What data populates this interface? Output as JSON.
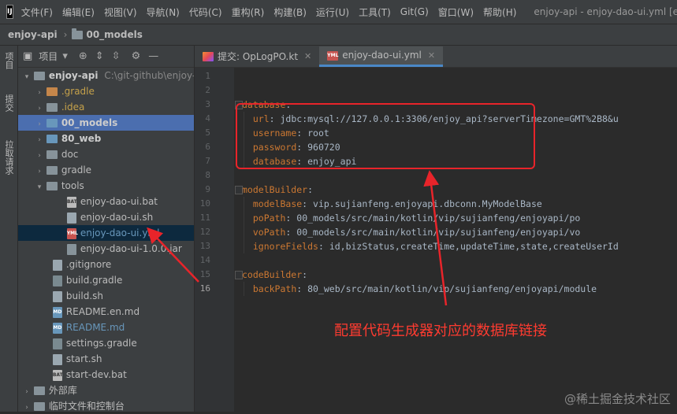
{
  "menubar": {
    "logo": "IJ",
    "items": [
      "文件(F)",
      "编辑(E)",
      "视图(V)",
      "导航(N)",
      "代码(C)",
      "重构(R)",
      "构建(B)",
      "运行(U)",
      "工具(T)",
      "Git(G)",
      "窗口(W)",
      "帮助(H)"
    ],
    "window_title": "enjoy-api - enjoy-dao-ui.yml [en"
  },
  "breadcrumb": {
    "project": "enjoy-api",
    "folder": "00_models"
  },
  "left_stripe": {
    "tab_project": "项目",
    "tab_commit": "提交",
    "tab_pull": "拉取请求"
  },
  "project_panel": {
    "title": "项目",
    "root_name": "enjoy-api",
    "root_path": "C:\\git-github\\enjoy-a",
    "rows": [
      {
        "label": ".gradle",
        "kind": "folder-orange"
      },
      {
        "label": ".idea",
        "kind": "folder-grey"
      },
      {
        "label": "00_models",
        "kind": "folder-blue"
      },
      {
        "label": "80_web",
        "kind": "folder-blue"
      },
      {
        "label": "doc",
        "kind": "folder-grey"
      },
      {
        "label": "gradle",
        "kind": "folder-grey"
      },
      {
        "label": "tools",
        "kind": "folder-grey"
      },
      {
        "label": "enjoy-dao-ui.bat",
        "kind": "bat"
      },
      {
        "label": "enjoy-dao-ui.sh",
        "kind": "sh"
      },
      {
        "label": "enjoy-dao-ui.yml",
        "kind": "yml"
      },
      {
        "label": "enjoy-dao-ui-1.0.0.jar",
        "kind": "jar"
      },
      {
        "label": ".gitignore",
        "kind": "file"
      },
      {
        "label": "build.gradle",
        "kind": "gradle"
      },
      {
        "label": "build.sh",
        "kind": "sh"
      },
      {
        "label": "README.en.md",
        "kind": "md"
      },
      {
        "label": "README.md",
        "kind": "md"
      },
      {
        "label": "settings.gradle",
        "kind": "gradle"
      },
      {
        "label": "start.sh",
        "kind": "sh"
      },
      {
        "label": "start-dev.bat",
        "kind": "bat"
      },
      {
        "label": "外部库",
        "kind": "lib"
      },
      {
        "label": "临时文件和控制台",
        "kind": "scratch"
      }
    ]
  },
  "editor_tabs": [
    {
      "label": "提交: OpLogPO.kt",
      "icon": "kotlin-file-icon"
    },
    {
      "label": "enjoy-dao-ui.yml",
      "icon": "yaml-file-icon"
    }
  ],
  "editor": {
    "line_numbers": [
      "1",
      "2",
      "3",
      "4",
      "5",
      "6",
      "7",
      "8",
      "9",
      "10",
      "11",
      "12",
      "13",
      "14",
      "15",
      "16"
    ],
    "lines": [
      {
        "indent": "",
        "key": "",
        "sep": "",
        "value": ""
      },
      {
        "indent": "",
        "key": "",
        "sep": "",
        "value": ""
      },
      {
        "indent": "",
        "key": "database",
        "sep": ":",
        "value": ""
      },
      {
        "indent": "  ",
        "key": "url",
        "sep": ": ",
        "value": "jdbc:mysql://127.0.0.1:3306/enjoy_api?serverTimezone=GMT%2B8&u"
      },
      {
        "indent": "  ",
        "key": "username",
        "sep": ": ",
        "value": "root"
      },
      {
        "indent": "  ",
        "key": "password",
        "sep": ": ",
        "value": "960720"
      },
      {
        "indent": "  ",
        "key": "database",
        "sep": ": ",
        "value": "enjoy_api"
      },
      {
        "indent": "",
        "key": "",
        "sep": "",
        "value": ""
      },
      {
        "indent": "",
        "key": "modelBuilder",
        "sep": ":",
        "value": ""
      },
      {
        "indent": "  ",
        "key": "modelBase",
        "sep": ": ",
        "value": "vip.sujianfeng.enjoyapi.dbconn.MyModelBase"
      },
      {
        "indent": "  ",
        "key": "poPath",
        "sep": ": ",
        "value": "00_models/src/main/kotlin/vip/sujianfeng/enjoyapi/po"
      },
      {
        "indent": "  ",
        "key": "voPath",
        "sep": ": ",
        "value": "00_models/src/main/kotlin/vip/sujianfeng/enjoyapi/vo"
      },
      {
        "indent": "  ",
        "key": "ignoreFields",
        "sep": ": ",
        "value": "id,bizStatus,createTime,updateTime,state,createUserId"
      },
      {
        "indent": "",
        "key": "",
        "sep": "",
        "value": ""
      },
      {
        "indent": "",
        "key": "codeBuilder",
        "sep": ":",
        "value": ""
      },
      {
        "indent": "  ",
        "key": "backPath",
        "sep": ": ",
        "value": "80_web/src/main/kotlin/vip/sujianfeng/enjoyapi/module"
      }
    ]
  },
  "annotation": {
    "text": "配置代码生成器对应的数据库链接",
    "color": "#ff3b30"
  },
  "watermark": "@稀土掘金技术社区"
}
